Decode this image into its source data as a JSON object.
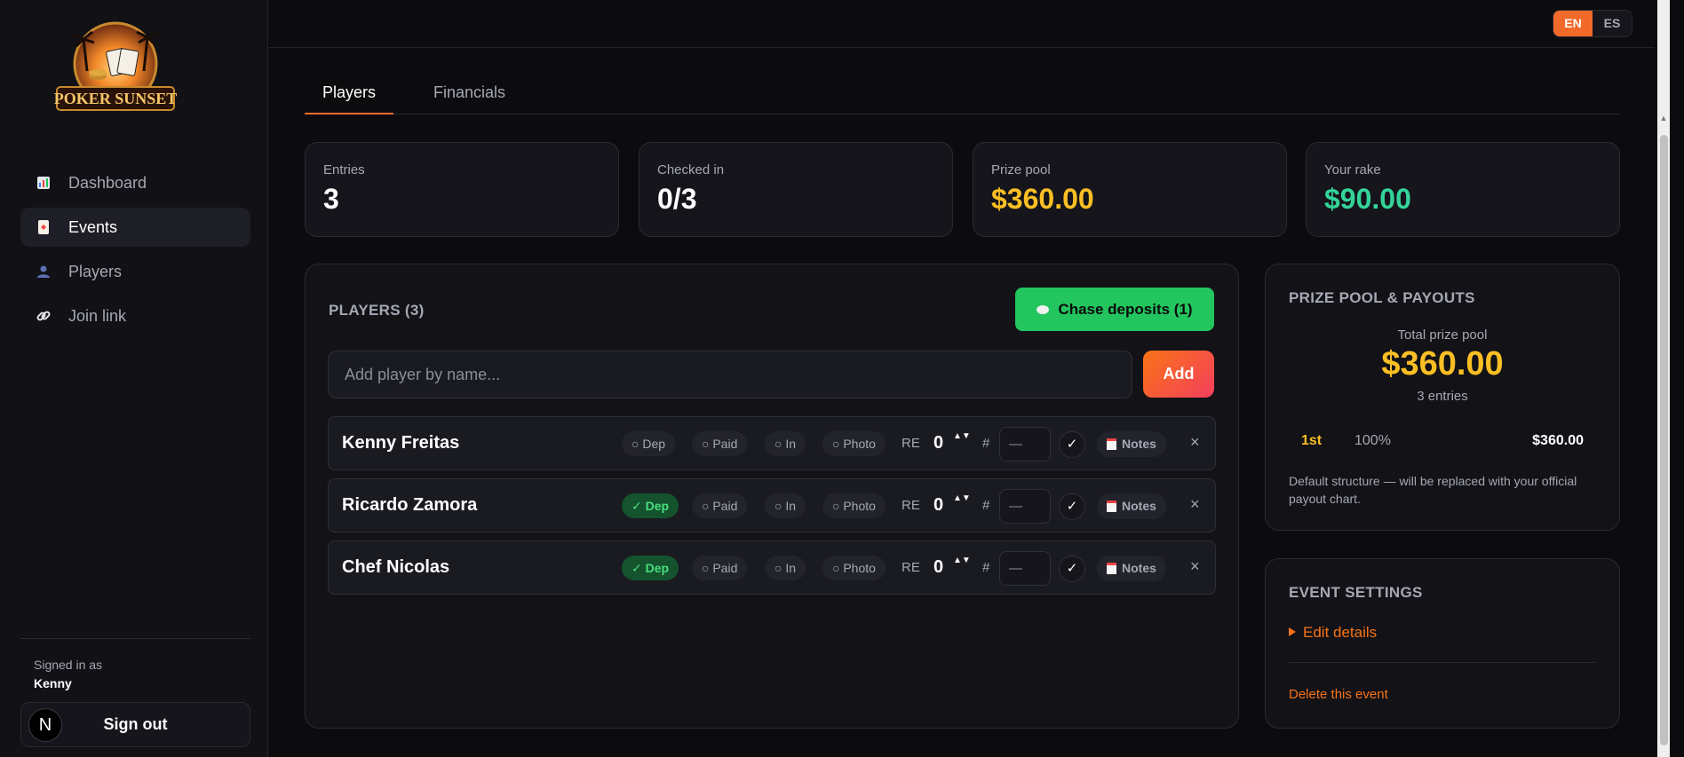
{
  "brand": {
    "logo_text": "POKER SUNSET"
  },
  "language": {
    "options": [
      "EN",
      "ES"
    ],
    "selected": "EN"
  },
  "sidebar": {
    "items": [
      {
        "label": "Dashboard",
        "icon": "bar-chart-icon"
      },
      {
        "label": "Events",
        "icon": "card-icon",
        "active": true
      },
      {
        "label": "Players",
        "icon": "user-icon"
      },
      {
        "label": "Join link",
        "icon": "link-icon"
      }
    ],
    "signed_in_label": "Signed in as",
    "user": "Kenny",
    "avatar_letter": "N",
    "sign_out": "Sign out"
  },
  "tabs": [
    {
      "label": "Players",
      "active": true
    },
    {
      "label": "Financials",
      "active": false
    }
  ],
  "stats": [
    {
      "label": "Entries",
      "value": "3",
      "color": "#ffffff"
    },
    {
      "label": "Checked in",
      "value": "0/3",
      "color": "#ffffff"
    },
    {
      "label": "Prize pool",
      "value": "$360.00",
      "color": "#fbbf24"
    },
    {
      "label": "Your rake",
      "value": "$90.00",
      "color": "#34d399"
    }
  ],
  "players_panel": {
    "title": "PLAYERS (3)",
    "chase_button": "Chase deposits (1)",
    "add_placeholder": "Add player by name...",
    "add_button": "Add",
    "re_label": "RE",
    "seat_label": "#",
    "seat_placeholder": "—",
    "check_glyph": "✓",
    "notes_label": "Notes",
    "remove_glyph": "×",
    "stepper_glyph": "▲▼",
    "rows": [
      {
        "name": "Kenny Freitas",
        "dep": "○ Dep",
        "paid": "○ Paid",
        "in": "○ In",
        "photo": "○ Photo",
        "re": "0",
        "dep_on": false
      },
      {
        "name": "Ricardo Zamora",
        "dep": "✓ Dep",
        "paid": "○ Paid",
        "in": "○ In",
        "photo": "○ Photo",
        "re": "0",
        "dep_on": true
      },
      {
        "name": "Chef Nicolas",
        "dep": "✓ Dep",
        "paid": "○ Paid",
        "in": "○ In",
        "photo": "○ Photo",
        "re": "0",
        "dep_on": true
      }
    ]
  },
  "prize_panel": {
    "title": "PRIZE POOL & PAYOUTS",
    "total_label": "Total prize pool",
    "total_value": "$360.00",
    "entries": "3 entries",
    "payouts": [
      {
        "place": "1st",
        "percent": "100%",
        "amount": "$360.00"
      }
    ],
    "note": "Default structure — will be replaced with your official payout chart."
  },
  "settings_panel": {
    "title": "EVENT SETTINGS",
    "edit_details": "Edit details",
    "delete_event": "Delete this event"
  },
  "colors": {
    "accent": "#f26a2a",
    "success": "#22c55e",
    "gold": "#fbbf24",
    "rake": "#34d399"
  }
}
